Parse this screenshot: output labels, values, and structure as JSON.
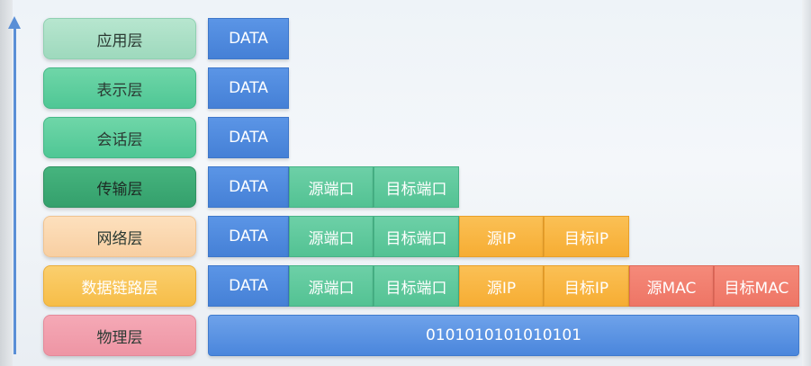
{
  "layers": [
    {
      "name": "应用层"
    },
    {
      "name": "表示层"
    },
    {
      "name": "会话层"
    },
    {
      "name": "传输层"
    },
    {
      "name": "网络层"
    },
    {
      "name": "数据链路层"
    },
    {
      "name": "物理层"
    }
  ],
  "fields": {
    "data": "DATA",
    "src_port": "源端口",
    "dst_port": "目标端口",
    "src_ip": "源IP",
    "dst_ip": "目标IP",
    "src_mac": "源MAC",
    "dst_mac": "目标MAC"
  },
  "physical_bits": "0101010101010101",
  "colors": {
    "data": "#4a86dc",
    "port": "#53c293",
    "ip": "#f6ad33",
    "mac": "#ee7565",
    "arrow": "#5a8fd6"
  }
}
